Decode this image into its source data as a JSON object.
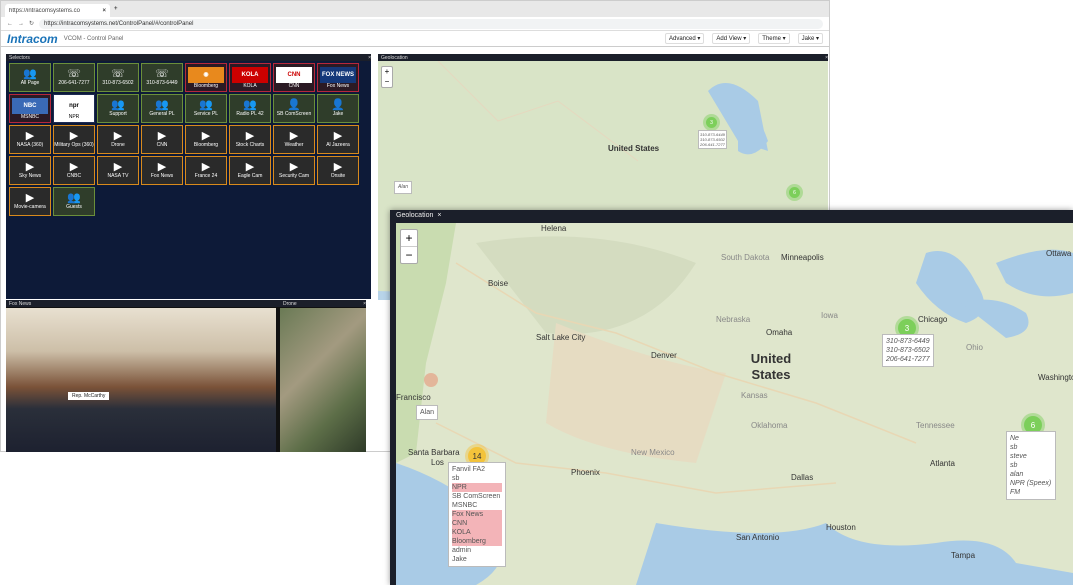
{
  "browser": {
    "tab_title": "https://intracomsystems.co",
    "url": "https://intracomsystems.net/ControlPanel/#/controlPanel"
  },
  "app": {
    "logo": "Intracom",
    "title": "VCOM - Control Panel",
    "menu": [
      "Advanced ▾",
      "Add View ▾",
      "Theme ▾",
      "Jake ▾"
    ]
  },
  "selectors": {
    "title": "Selectors",
    "tiles": [
      {
        "label": "All Page",
        "icon": "group-icon",
        "style": "g"
      },
      {
        "label": "206-641-7277",
        "icon": "sip-phone-icon",
        "style": "g"
      },
      {
        "label": "310-873-6502",
        "icon": "sip-phone-icon",
        "style": "g"
      },
      {
        "label": "310-873-6449",
        "icon": "sip-phone-icon",
        "style": "g"
      },
      {
        "label": "Bloomberg",
        "icon": "radio-icon",
        "style": "r",
        "logo": "radio"
      },
      {
        "label": "KOLA",
        "icon": "kola-logo",
        "style": "r",
        "logo": "KOLA"
      },
      {
        "label": "CNN",
        "icon": "cnn-logo",
        "style": "r",
        "logo": "CNN"
      },
      {
        "label": "Fox News",
        "icon": "fox-logo",
        "style": "r",
        "logo": "FOX NEWS"
      },
      {
        "label": "MSNBC",
        "icon": "nbc-logo",
        "style": "r",
        "logo": "NBC"
      },
      {
        "label": "NPR",
        "icon": "npr-logo",
        "style": "w",
        "logo": "npr"
      },
      {
        "label": "Support",
        "icon": "group-icon",
        "style": "g"
      },
      {
        "label": "General PL",
        "icon": "group-icon",
        "style": "g"
      },
      {
        "label": "Service PL",
        "icon": "group-icon",
        "style": "g"
      },
      {
        "label": "Radio PL 42",
        "icon": "group-icon",
        "style": "g"
      },
      {
        "label": "SB ComScreen",
        "icon": "person-icon",
        "style": "g"
      },
      {
        "label": "Jake",
        "icon": "person-icon",
        "style": "g"
      },
      {
        "label": "NASA (360)",
        "icon": "video-icon",
        "style": "o"
      },
      {
        "label": "Military Ops (360)",
        "icon": "video-icon",
        "style": "o"
      },
      {
        "label": "Drone",
        "icon": "video-icon",
        "style": "o"
      },
      {
        "label": "CNN",
        "icon": "video-icon",
        "style": "o"
      },
      {
        "label": "Bloomberg",
        "icon": "video-icon",
        "style": "o"
      },
      {
        "label": "Stock Charts",
        "icon": "video-icon",
        "style": "o"
      },
      {
        "label": "Weather",
        "icon": "video-icon",
        "style": "o"
      },
      {
        "label": "Al Jazeera",
        "icon": "video-icon",
        "style": "o"
      },
      {
        "label": "Sky News",
        "icon": "video-icon",
        "style": "o"
      },
      {
        "label": "CNBC",
        "icon": "video-icon",
        "style": "o"
      },
      {
        "label": "NASA TV",
        "icon": "video-icon",
        "style": "o"
      },
      {
        "label": "Fox News",
        "icon": "video-icon",
        "style": "o"
      },
      {
        "label": "France 24",
        "icon": "video-icon",
        "style": "o"
      },
      {
        "label": "Eagle Cam",
        "icon": "video-icon",
        "style": "o"
      },
      {
        "label": "Security Cam",
        "icon": "video-icon",
        "style": "o"
      },
      {
        "label": "Onsite",
        "icon": "video-icon",
        "style": "o"
      },
      {
        "label": "Movie-camera",
        "icon": "video-icon",
        "style": "o"
      },
      {
        "label": "Guests",
        "icon": "group-icon",
        "style": "g"
      }
    ]
  },
  "small_map": {
    "title": "Geolocation",
    "country": "United States",
    "cluster_green": "3",
    "cluster_green2": "6",
    "popup": [
      "310-873-6449",
      "310-873-6502",
      "206-641-7277"
    ],
    "alan": "Alan"
  },
  "video_panels": {
    "left_title": "Fox News",
    "right_title": "Drone",
    "caption": "Rep. McCarthy"
  },
  "geo": {
    "title": "Geolocation",
    "zoom_in": "+",
    "zoom_out": "−",
    "country": "United States",
    "cities": {
      "helena": "Helena",
      "minneapolis": "Minneapolis",
      "ottawa": "Ottawa",
      "boise": "Boise",
      "south_dakota": "South Dakota",
      "chicago": "Chicago",
      "nebraska": "Nebraska",
      "omaha": "Omaha",
      "iowa": "Iowa",
      "salt_lake": "Salt Lake City",
      "denver": "Denver",
      "ohio": "Ohio",
      "washington": "Washingto",
      "kansas": "Kansas",
      "oklahoma": "Oklahoma",
      "tennessee": "Tennessee",
      "new_mexico": "New Mexico",
      "atlanta": "Atlanta",
      "phoenix": "Phoenix",
      "dallas": "Dallas",
      "santa_barbara": "Santa Barbara",
      "san_antonio": "San Antonio",
      "houston": "Houston",
      "tampa": "Tampa",
      "sf": "Francisco",
      "los": "Los"
    },
    "cluster_chicago": "3",
    "popup_chicago": [
      "310-873-6449",
      "310-873-6502",
      "206-641-7277"
    ],
    "cluster_east": "6",
    "popup_east": [
      "Ne",
      "sb",
      "steve",
      "sb",
      "alan",
      "NPR (Speex)",
      "FM"
    ],
    "cluster_la": "14",
    "popup_la": [
      {
        "t": "Fanvil FA2",
        "hl": false
      },
      {
        "t": "sb",
        "hl": false
      },
      {
        "t": "NPR",
        "hl": true
      },
      {
        "t": "SB ComScreen",
        "hl": false
      },
      {
        "t": "MSNBC",
        "hl": false
      },
      {
        "t": "Fox News",
        "hl": true
      },
      {
        "t": "CNN",
        "hl": true
      },
      {
        "t": "KOLA",
        "hl": true
      },
      {
        "t": "Bloomberg",
        "hl": true
      },
      {
        "t": "admin",
        "hl": false
      },
      {
        "t": "Jake",
        "hl": false
      }
    ],
    "alan": "Alan"
  }
}
